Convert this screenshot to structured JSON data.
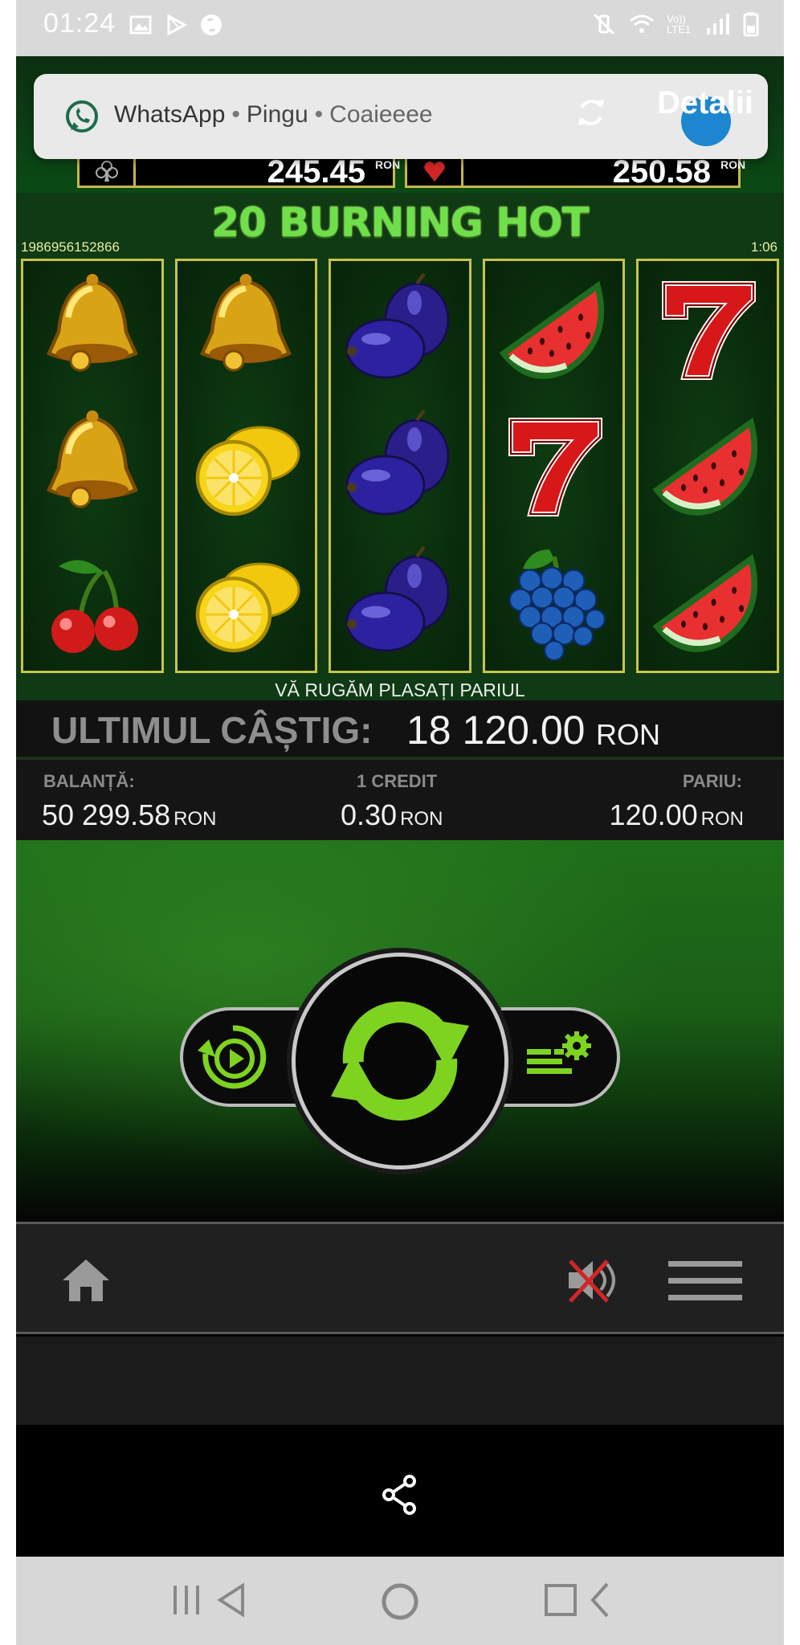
{
  "status_bar": {
    "time": "01:24",
    "lte_label": "Vo)) LTE1"
  },
  "notification": {
    "app": "WhatsApp",
    "sender": "Pingu",
    "message": "Coaieeee",
    "action": "Detalii"
  },
  "jackpots": {
    "clubs_amount": "245.45",
    "hearts_amount": "250.58",
    "currency": "RON"
  },
  "game": {
    "title": "20 BURNING HOT",
    "id": "1986956152866",
    "time": "1:06",
    "reels": [
      [
        "bell",
        "bell",
        "cherry"
      ],
      [
        "bell",
        "lemon",
        "lemon"
      ],
      [
        "plum",
        "plum",
        "plum"
      ],
      [
        "watermelon",
        "seven",
        "grapes"
      ],
      [
        "seven",
        "watermelon",
        "watermelon"
      ]
    ],
    "prompt": "VĂ RUGĂM PLASAȚI PARIUL",
    "last_win_label": "ULTIMUL CÂȘTIG:",
    "last_win_value": "18 120.00",
    "last_win_currency": "RON"
  },
  "info": {
    "balance_label": "BALANȚĂ:",
    "balance_value": "50 299.58",
    "credit_label": "1 CREDIT",
    "credit_value": "0.30",
    "bet_label": "PARIU:",
    "bet_value": "120.00",
    "currency": "RON"
  },
  "icons": {
    "autoplay": "autoplay-icon",
    "spin": "spin-icon",
    "bet-settings": "bet-settings-icon",
    "home": "home-icon",
    "mute": "sound-muted-icon",
    "menu": "hamburger-menu-icon",
    "share": "share-icon"
  },
  "colors": {
    "accent_green": "#7ed321",
    "reel_border": "#c6c34a",
    "title_green": "#6ee04a"
  }
}
